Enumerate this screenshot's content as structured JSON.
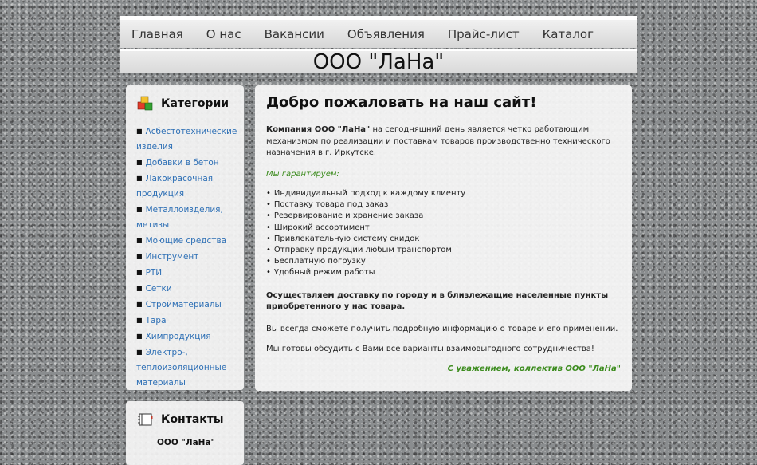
{
  "nav": [
    "Главная",
    "О нас",
    "Вакансии",
    "Объявления",
    "Прайс-лист",
    "Каталог"
  ],
  "site_title": "ООО \"ЛаНа\"",
  "categories": {
    "title": "Категории",
    "items": [
      "Асбестотехнические изделия",
      "Добавки в бетон",
      "Лакокрасочная продукция",
      "Металлоизделия, метизы",
      "Моющие средства",
      "Инструмент",
      "РТИ",
      "Сетки",
      "Стройматериалы",
      "Тара",
      "Химпродукция",
      "Электро-, теплоизоляционные материалы"
    ]
  },
  "contacts": {
    "title": "Контакты",
    "company": "ООО \"ЛаНа\""
  },
  "main": {
    "heading": "Добро пожаловать на наш сайт!",
    "intro_bold": "Компания ООО \"ЛаНа\"",
    "intro_rest": " на сегодняшний день является четко работающим механизмом по реализации и поставкам товаров производственно технического назначения в г. Иркутске.",
    "guarantee": "Мы гарантируем:",
    "guarantees": [
      "Индивидуальный подход  к каждому клиенту",
      "Поставку товара под заказ",
      "Резервирование и хранение заказа",
      "Широкий ассортимент",
      "Привлекательную систему скидок",
      "Отправку продукции любым транспортом",
      "Бесплатную погрузку",
      "Удобный режим работы"
    ],
    "delivery": "Осуществляем доставку по городу и в близлежащие населенные пункты приобретенного у нас товара.",
    "info": "Вы всегда сможете получить подробную информацию о товаре и его применении.",
    "cooperation": "Мы готовы обсудить с Вами все варианты взаимовыгодного сотрудничества!",
    "regards": "С уважением, коллектив ООО \"ЛаНа\""
  },
  "colors": {
    "link": "#2d6fb5",
    "accent_green": "#3c8c1e"
  }
}
